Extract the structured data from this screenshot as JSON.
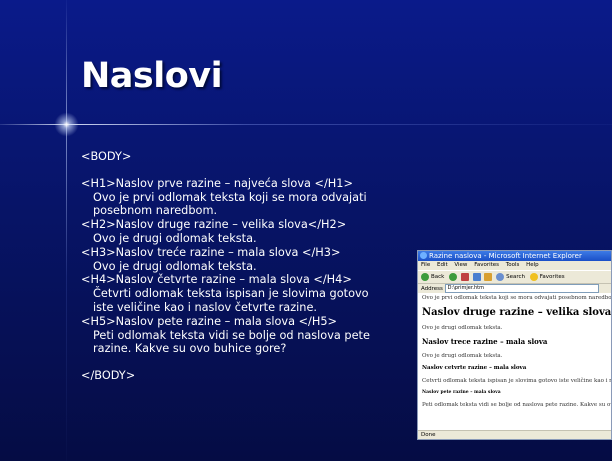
{
  "slide": {
    "title": "Naslovi",
    "lines": [
      {
        "text": "<BODY>",
        "indent": false
      },
      {
        "gap": true
      },
      {
        "text": "<H1>Naslov prve razine – najveća slova </H1>",
        "indent": false
      },
      {
        "text": "Ovo je prvi odlomak teksta koji se mora odvajati",
        "indent": true
      },
      {
        "text": "posebnom naredbom.",
        "indent": true
      },
      {
        "text": "<H2>Naslov druge razine – velika slova</H2>",
        "indent": false
      },
      {
        "text": "Ovo je drugi odlomak teksta.",
        "indent": true
      },
      {
        "text": "<H3>Naslov treće razine – mala slova </H3>",
        "indent": false
      },
      {
        "text": "Ovo je drugi odlomak teksta.",
        "indent": true
      },
      {
        "text": "<H4>Naslov četvrte razine – mala slova </H4>",
        "indent": false
      },
      {
        "text": "Četvrti odlomak teksta ispisan je slovima gotovo",
        "indent": true
      },
      {
        "text": "iste veličine kao i naslov četvrte razine.",
        "indent": true
      },
      {
        "text": "<H5>Naslov pete razine – mala slova </H5>",
        "indent": false
      },
      {
        "text": "Peti odlomak teksta vidi se bolje od naslova pete",
        "indent": true
      },
      {
        "text": "razine. Kakve su ovo buhice gore?",
        "indent": true
      },
      {
        "gap": true
      },
      {
        "text": "</BODY>",
        "indent": false
      }
    ]
  },
  "browser": {
    "title": "Razine naslova - Microsoft Internet Explorer",
    "menu": [
      "File",
      "Edit",
      "View",
      "Favorites",
      "Tools",
      "Help"
    ],
    "toolbar": {
      "back": "Back",
      "search": "Search",
      "favorites": "Favorites"
    },
    "address_label": "Address",
    "address_value": "D:\\primjer.htm",
    "content": {
      "p1": "Ovo je prvi odlomak teksta koji se mora odvajati posebnom naredbom.",
      "h2": "Naslov druge razine – velika slova",
      "p2": "Ovo je drugi odlomak teksta.",
      "h3": "Naslov trece razine – mala slova",
      "p3": "Ovo je drugi odlomak teksta.",
      "h4": "Naslov cetvrte razine – mala slova",
      "p4": "Cetvrti odlomak teksta ispisan je slovima gotovo iste veličine kao i naslov četvrte razine.",
      "h5": "Naslov pete razine – mala slova",
      "p5": "Peti odlomak teksta vidi se bolje od naslova pete razine. Kakve su ovo buhice gore?"
    },
    "status": "Done"
  },
  "colors": {
    "background": "#071467",
    "text": "#ffffff"
  }
}
